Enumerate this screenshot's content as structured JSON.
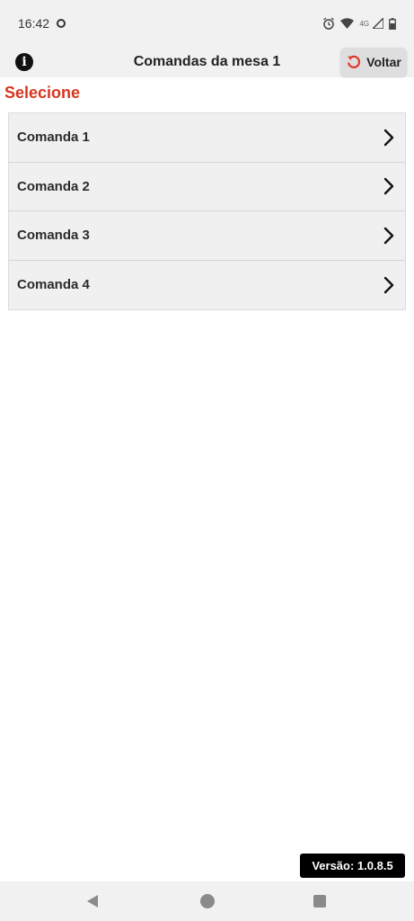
{
  "status_bar": {
    "time": "16:42",
    "network_label": "4G",
    "icons": [
      "ring-indicator-icon",
      "alarm-icon",
      "wifi-icon",
      "signal-icon",
      "battery-icon"
    ]
  },
  "app_bar": {
    "title": "Comandas da mesa 1",
    "info_icon": "info-icon",
    "back_label": "Voltar",
    "back_icon": "undo-arrow-icon",
    "back_icon_color": "#e0342a"
  },
  "content": {
    "section_title": "Selecione",
    "section_title_color": "#d6361e",
    "items": [
      {
        "label": "Comanda 1",
        "icon": "chevron-right-icon"
      },
      {
        "label": "Comanda 2",
        "icon": "chevron-right-icon"
      },
      {
        "label": "Comanda 3",
        "icon": "chevron-right-icon"
      },
      {
        "label": "Comanda 4",
        "icon": "chevron-right-icon"
      }
    ]
  },
  "footer": {
    "version": "Versão: 1.0.8.5"
  },
  "nav_bar": {
    "icons": [
      "nav-back-icon",
      "nav-home-icon",
      "nav-recents-icon"
    ]
  }
}
